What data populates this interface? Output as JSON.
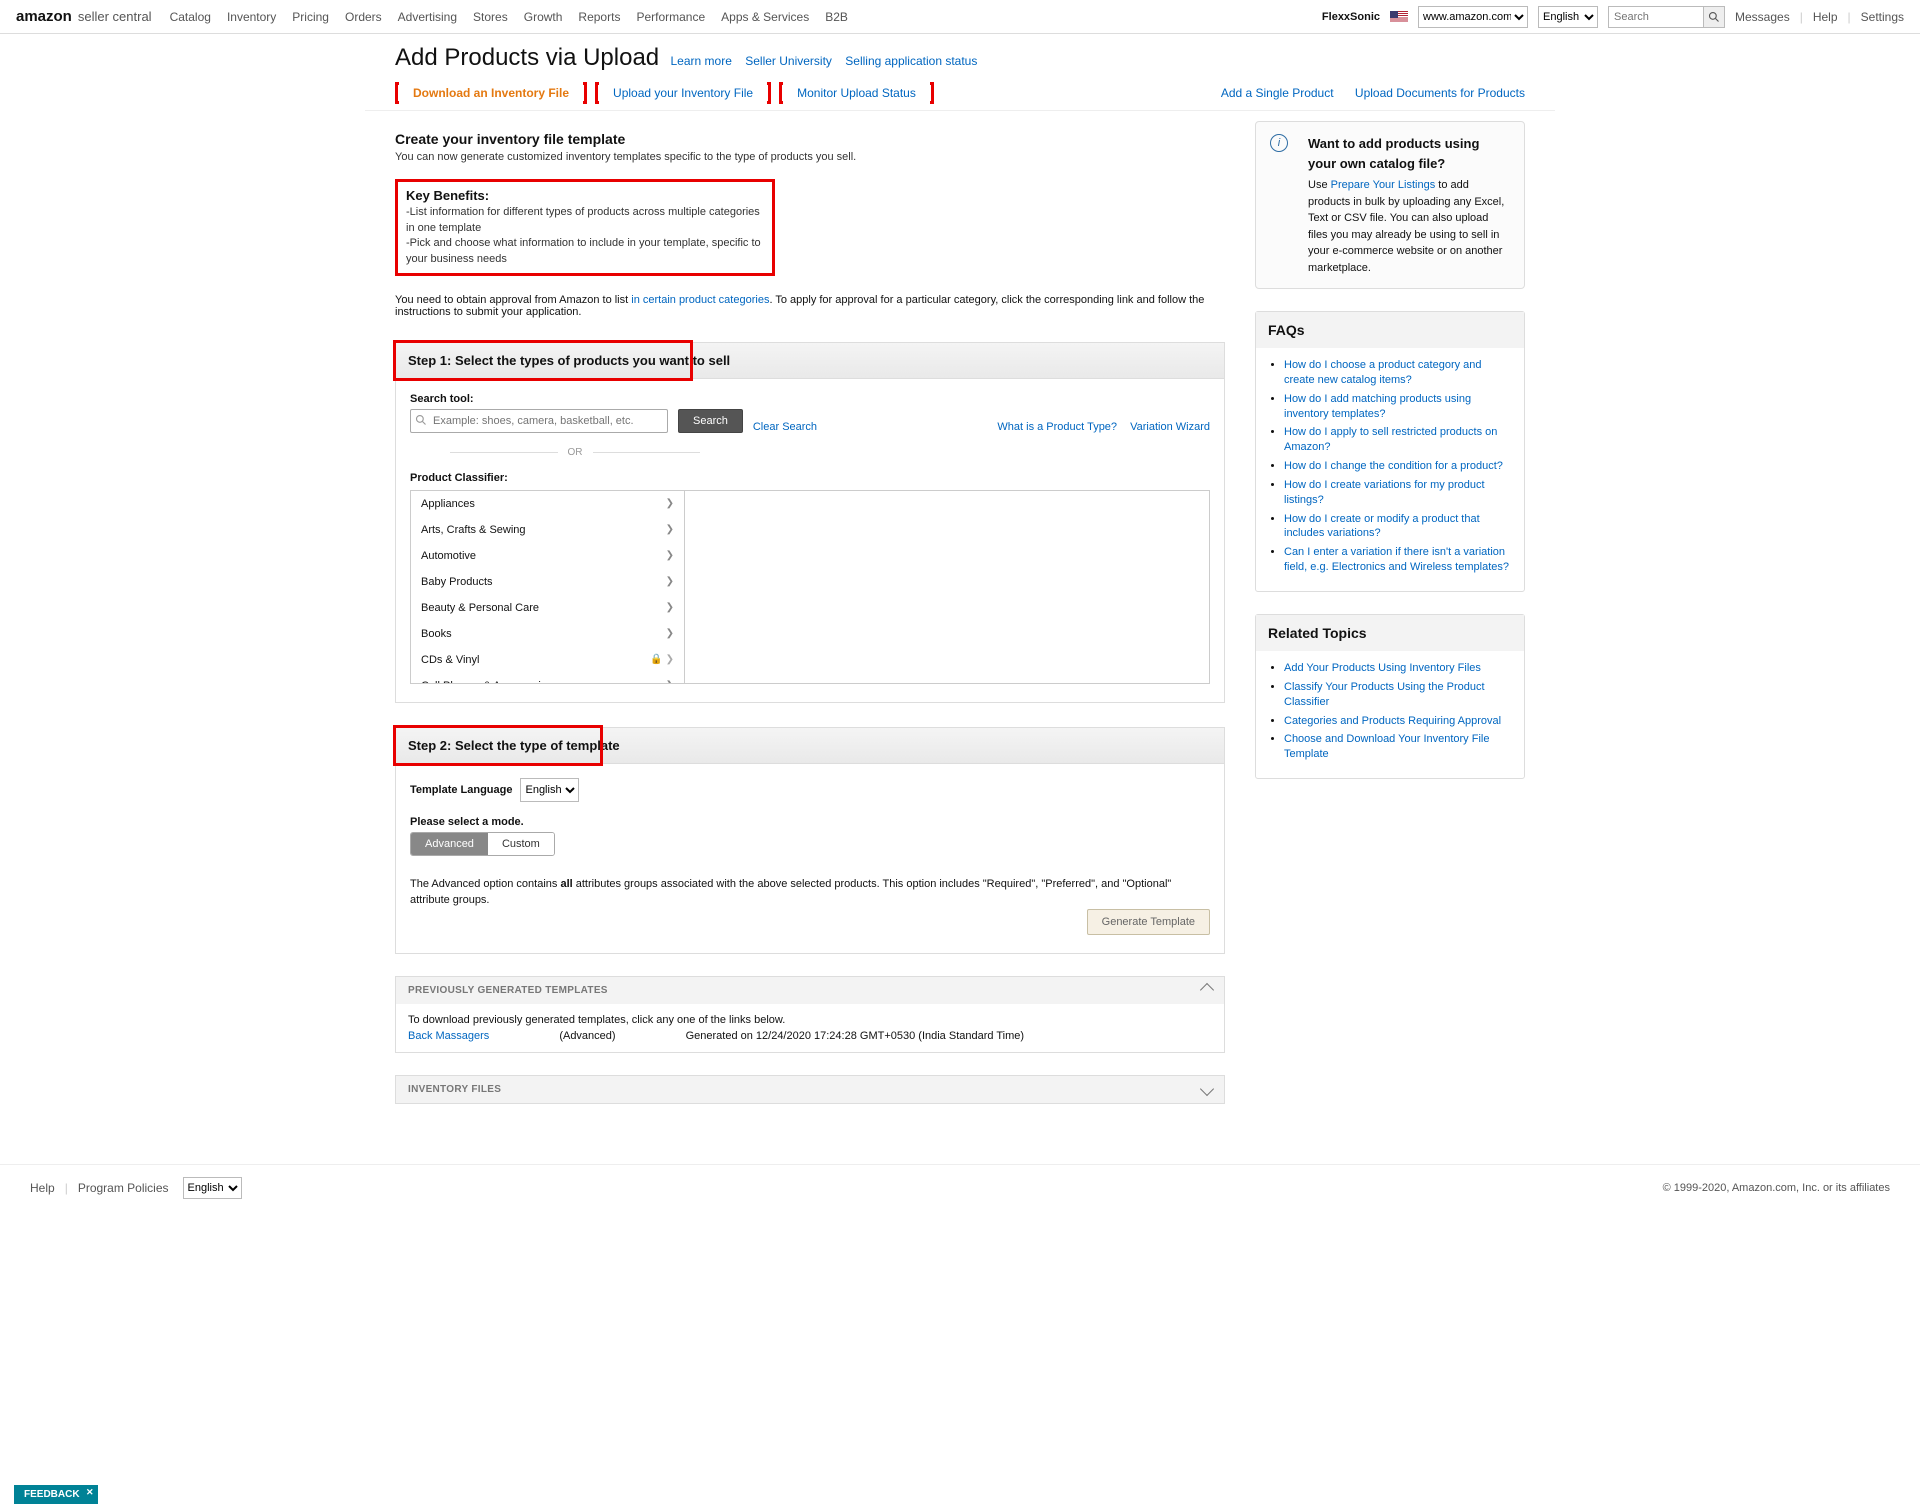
{
  "topnav": {
    "brand_amazon": "amazon",
    "brand_sc": "seller central",
    "menu": [
      "Catalog",
      "Inventory",
      "Pricing",
      "Orders",
      "Advertising",
      "Stores",
      "Growth",
      "Reports",
      "Performance",
      "Apps & Services",
      "B2B"
    ],
    "seller_name": "FlexxSonic",
    "domain": "www.amazon.com",
    "language": "English",
    "search_placeholder": "Search",
    "links": {
      "messages": "Messages",
      "help": "Help",
      "settings": "Settings"
    }
  },
  "page_title": "Add Products via Upload",
  "title_links": {
    "learn_more": "Learn more",
    "seller_university": "Seller University",
    "selling_application_status": "Selling application status"
  },
  "tabs": {
    "download": "Download an Inventory File",
    "upload": "Upload your Inventory File",
    "monitor": "Monitor Upload Status"
  },
  "tabs_right": {
    "add_single": "Add a Single Product",
    "upload_docs": "Upload Documents for Products"
  },
  "intro": {
    "heading": "Create your inventory file template",
    "sub": "You can now generate customized inventory templates specific to the type of products you sell."
  },
  "benefits": {
    "heading": "Key Benefits:",
    "b1": "-List information for different types of products across multiple categories in one template",
    "b2": "-Pick and choose what information to include in your template, specific to your business needs"
  },
  "approval": {
    "pre": "You need to obtain approval from Amazon to list ",
    "link": "in certain product categories",
    "post": ". To apply for approval for a particular category, click the corresponding link and follow the instructions to submit your application."
  },
  "step1": {
    "title": "Step 1: Select the types of products you want to sell",
    "search_label": "Search tool:",
    "search_placeholder": "Example: shoes, camera, basketball, etc.",
    "search_btn": "Search",
    "clear": "Clear Search",
    "what_is": "What is a Product Type?",
    "variation_wizard": "Variation Wizard",
    "or": "OR",
    "classifier_label": "Product Classifier:",
    "categories": [
      "Appliances",
      "Arts, Crafts & Sewing",
      "Automotive",
      "Baby Products",
      "Beauty & Personal Care",
      "Books",
      "CDs & Vinyl",
      "Cell Phones & Accessories"
    ]
  },
  "step2": {
    "title": "Step 2: Select the type of template",
    "template_language_label": "Template Language",
    "template_language": "English",
    "mode_label": "Please select a mode.",
    "mode_advanced": "Advanced",
    "mode_custom": "Custom",
    "desc_pre": "The Advanced option contains ",
    "desc_bold": "all",
    "desc_post": " attributes groups associated with the above selected products. This option includes \"Required\", \"Preferred\", and \"Optional\" attribute groups.",
    "generate_btn": "Generate Template"
  },
  "previously": {
    "title": "PREVIOUSLY GENERATED TEMPLATES",
    "intro": "To download previously generated templates, click any one of the links below.",
    "item_link": "Back Massagers",
    "item_mode": "(Advanced)",
    "item_date": "Generated on 12/24/2020 17:24:28 GMT+0530 (India Standard Time)"
  },
  "inventory_files_title": "INVENTORY FILES",
  "sidebar": {
    "info_heading": "Want to add products using your own catalog file?",
    "info_text_pre": "Use ",
    "info_link": "Prepare Your Listings",
    "info_text_post": " to add products in bulk by uploading any Excel, Text or CSV file. You can also upload files you may already be using to sell in your e-commerce website or on another marketplace.",
    "faqs_title": "FAQs",
    "faqs": [
      "How do I choose a product category and create new catalog items?",
      "How do I add matching products using inventory templates?",
      "How do I apply to sell restricted products on Amazon?",
      "How do I change the condition for a product?",
      "How do I create variations for my product listings?",
      "How do I create or modify a product that includes variations?",
      "Can I enter a variation if there isn't a variation field, e.g. Electronics and Wireless templates?"
    ],
    "related_title": "Related Topics",
    "related": [
      "Add Your Products Using Inventory Files",
      "Classify Your Products Using the Product Classifier",
      "Categories and Products Requiring Approval",
      "Choose and Download Your Inventory File Template"
    ]
  },
  "footer": {
    "help": "Help",
    "policies": "Program Policies",
    "language": "English",
    "copyright": "© 1999-2020, Amazon.com, Inc. or its affiliates"
  },
  "feedback": "FEEDBACK"
}
